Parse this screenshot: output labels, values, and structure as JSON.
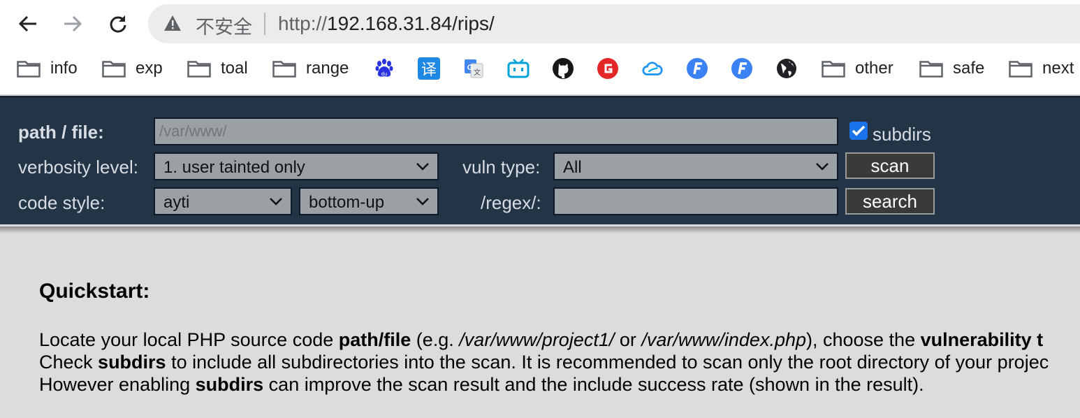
{
  "browser": {
    "insecure_label": "不安全",
    "url_protocol": "http://",
    "url_rest": "192.168.31.84/rips/",
    "bookmarks": [
      {
        "label": "info"
      },
      {
        "label": "exp"
      },
      {
        "label": "toal"
      },
      {
        "label": "range"
      },
      {
        "label": "other"
      },
      {
        "label": "safe"
      },
      {
        "label": "next"
      }
    ],
    "translate_glyph": "译"
  },
  "toolbar": {
    "path_label": "path / file:",
    "path_placeholder": "/var/www/",
    "subdirs_label": "subdirs",
    "verbosity_label": "verbosity level:",
    "verbosity_value": "1. user tainted only",
    "vuln_label": "vuln type:",
    "vuln_value": "All",
    "scan_label": "scan",
    "code_style_label": "code style:",
    "code_style_value": "ayti",
    "order_value": "bottom-up",
    "regex_label": "/regex/:",
    "search_label": "search"
  },
  "quickstart": {
    "title": "Quickstart:",
    "line1": {
      "a": "Locate your local PHP source code ",
      "b": "path/file",
      "c": " (e.g. ",
      "d": "/var/www/project1/",
      "e": " or ",
      "f": "/var/www/index.php",
      "g": "), choose the ",
      "h": "vulnerability t"
    },
    "line2": {
      "a": "Check ",
      "b": "subdirs",
      "c": " to include all subdirectories into the scan. It is recommended to scan only the root directory of your projec"
    },
    "line3": {
      "a": "However enabling ",
      "b": "subdirs",
      "c": " can improve the scan result and the include success rate (shown in the result)."
    }
  }
}
